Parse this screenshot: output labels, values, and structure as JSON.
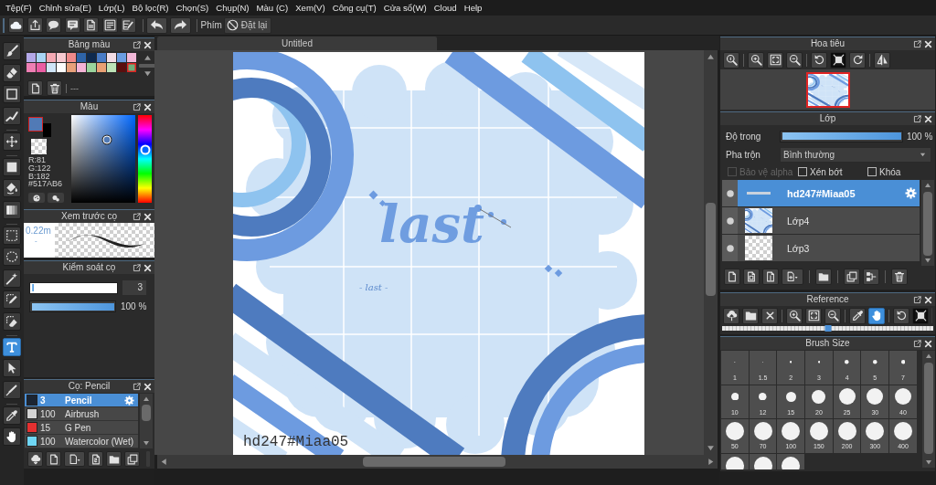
{
  "menu_bar": [
    "Tệp(F)",
    "Chỉnh sửa(E)",
    "Lớp(L)",
    "Bộ lọc(R)",
    "Chọn(S)",
    "Chụp(N)",
    "Màu (C)",
    "Xem(V)",
    "Công cụ(T)",
    "Cửa sổ(W)",
    "Cloud",
    "Help"
  ],
  "toolbar": {
    "shortcut_label": "Phím",
    "reset_button": "Đặt lại"
  },
  "tools": [
    {
      "kind": "brush",
      "selected": false
    },
    {
      "kind": "eraser",
      "selected": false
    },
    {
      "kind": "dot",
      "selected": false
    },
    {
      "kind": "polyline",
      "selected": false
    },
    {
      "kind": "move",
      "selected": false
    },
    {
      "kind": "fill",
      "selected": false
    },
    {
      "kind": "bucket",
      "selected": false
    },
    {
      "kind": "gradient",
      "selected": false
    },
    {
      "kind": "select",
      "selected": false
    },
    {
      "kind": "lasso",
      "selected": false
    },
    {
      "kind": "wand",
      "selected": false
    },
    {
      "kind": "selpen",
      "selected": false
    },
    {
      "kind": "selerase",
      "selected": false
    },
    {
      "kind": "text",
      "selected": true
    },
    {
      "kind": "operate",
      "selected": false
    },
    {
      "kind": "divide",
      "selected": false
    },
    {
      "kind": "dropper",
      "selected": false
    },
    {
      "kind": "hand",
      "selected": false
    }
  ],
  "palette": {
    "title": "Bảng màu",
    "swatches": [
      {
        "color": "#b3a8e8",
        "selected": false
      },
      {
        "color": "#a8d4f4",
        "selected": false
      },
      {
        "color": "#f4a9b3",
        "selected": false
      },
      {
        "color": "#f7c9d0",
        "selected": false
      },
      {
        "color": "#f08a8a",
        "selected": false
      },
      {
        "color": "#2e64a8",
        "selected": false
      },
      {
        "color": "#0f2a4e",
        "selected": false
      },
      {
        "color": "#4a7cc6",
        "selected": false
      },
      {
        "color": "#f3dde6",
        "selected": false
      },
      {
        "color": "#6a9de2",
        "selected": false
      },
      {
        "color": "#f2b8d8",
        "selected": false
      },
      {
        "color": "#ef7fb4",
        "selected": false
      },
      {
        "color": "#ea5da3",
        "selected": false
      },
      {
        "color": "#cfe5f7",
        "selected": false
      },
      {
        "color": "#fdfdfd",
        "selected": false
      },
      {
        "color": "#e8a07a",
        "selected": false
      },
      {
        "color": "#f4b3d6",
        "selected": false
      },
      {
        "color": "#9ad49c",
        "selected": false
      },
      {
        "color": "#e9a074",
        "selected": false
      },
      {
        "color": "#bde3b7",
        "selected": false
      },
      {
        "color": "#5a0e0e",
        "selected": false
      },
      {
        "color": "#6fae7a",
        "selected": true
      }
    ],
    "set_name": "---"
  },
  "color": {
    "title": "Màu",
    "swatches": [
      {
        "kind": "primary",
        "color": "#517ab6"
      },
      {
        "kind": "secondary",
        "color": "#000000"
      }
    ],
    "readouts": [
      "R:81",
      "G:122",
      "B:182",
      "#517AB6"
    ]
  },
  "brush_preview": {
    "title": "Xem trước cọ",
    "size": "0.22m",
    "mark": "-"
  },
  "brush_control": {
    "title": "Kiểm soát cọ",
    "size": {
      "level": 0.03,
      "value": "3"
    },
    "opacity": {
      "level": 1,
      "value": "100 %"
    }
  },
  "brushes": {
    "title": "Cọ: Pencil",
    "items": [
      {
        "size": "3",
        "name": "Pencil",
        "color": "#1b2533",
        "selected": true
      },
      {
        "size": "100",
        "name": "Airbrush",
        "color": "#d4d4d4",
        "selected": false
      },
      {
        "size": "15",
        "name": "G Pen",
        "color": "#e53030",
        "selected": false
      },
      {
        "size": "100",
        "name": "Watercolor (Wet)",
        "color": "#6fd6f4",
        "selected": false
      }
    ]
  },
  "document": {
    "tab": "Untitled",
    "lettering": "last",
    "caption": "- last -",
    "signature": "hd247#Miaa05"
  },
  "navigator": {
    "title": "Hoa tiêu",
    "tools": [
      {
        "kind": "actual",
        "on": false
      },
      {
        "kind": "zoomin",
        "on": false
      },
      {
        "kind": "fit",
        "on": false
      },
      {
        "kind": "zoomout",
        "on": false
      },
      {
        "kind": "rotleft",
        "on": false
      },
      {
        "kind": "frame",
        "on": true
      },
      {
        "kind": "rotright",
        "on": false
      },
      {
        "kind": "flip",
        "on": false
      }
    ]
  },
  "layers": {
    "title": "Lớp",
    "opacity_label": "Độ trong",
    "opacity": {
      "level": 1,
      "value": "100 %"
    },
    "blend_label": "Pha trộn",
    "blend": "Bình thường",
    "options": [
      {
        "label": "Bảo vệ alpha",
        "checked": false,
        "disabled": true
      },
      {
        "label": "Xén bớt",
        "checked": false,
        "disabled": false
      },
      {
        "label": "Khóa",
        "checked": false,
        "disabled": false
      }
    ],
    "items": [
      {
        "name": "hd247#Miaa05",
        "kind": "text",
        "visible": true,
        "selected": true
      },
      {
        "name": "Lớp4",
        "kind": "art",
        "visible": true,
        "selected": false
      },
      {
        "name": "Lớp3",
        "kind": "empty",
        "visible": true,
        "selected": false
      }
    ]
  },
  "reference": {
    "title": "Reference",
    "tools": [
      {
        "kind": "cloudup",
        "selected": false,
        "on": false
      },
      {
        "kind": "folder",
        "selected": false,
        "on": false
      },
      {
        "kind": "cross",
        "selected": false,
        "on": false
      },
      {
        "kind": "zoomin",
        "selected": false,
        "on": false
      },
      {
        "kind": "fit",
        "selected": false,
        "on": false
      },
      {
        "kind": "zoomout",
        "selected": false,
        "on": false
      },
      {
        "kind": "dropper",
        "selected": false,
        "on": false
      },
      {
        "kind": "hand",
        "selected": true,
        "on": false
      },
      {
        "kind": "rotleft",
        "selected": false,
        "on": false
      },
      {
        "kind": "frame",
        "selected": false,
        "on": true
      }
    ],
    "zoom": {
      "level": 0.5
    }
  },
  "brush_size": {
    "title": "Brush Size",
    "sizes": [
      {
        "label": "1",
        "kind": "hair"
      },
      {
        "label": "1.5",
        "kind": "hair"
      },
      {
        "label": "2",
        "kind": "tiny"
      },
      {
        "label": "3",
        "kind": "tiny"
      },
      {
        "label": "4",
        "kind": "small"
      },
      {
        "label": "5",
        "kind": "small"
      },
      {
        "label": "7",
        "kind": "small"
      },
      {
        "label": "10",
        "kind": "medium"
      },
      {
        "label": "12",
        "kind": "medium"
      },
      {
        "label": "15",
        "kind": "large"
      },
      {
        "label": "20",
        "kind": "big"
      },
      {
        "label": "25",
        "kind": "huge"
      },
      {
        "label": "30",
        "kind": "huge"
      },
      {
        "label": "40",
        "kind": "huge"
      },
      {
        "label": "50",
        "kind": "max"
      },
      {
        "label": "70",
        "kind": "max"
      },
      {
        "label": "100",
        "kind": "max"
      },
      {
        "label": "150",
        "kind": "max"
      },
      {
        "label": "200",
        "kind": "max"
      },
      {
        "label": "300",
        "kind": "max"
      },
      {
        "label": "400",
        "kind": "max"
      },
      {
        "kind": "max"
      },
      {
        "kind": "max"
      },
      {
        "kind": "max"
      }
    ]
  }
}
